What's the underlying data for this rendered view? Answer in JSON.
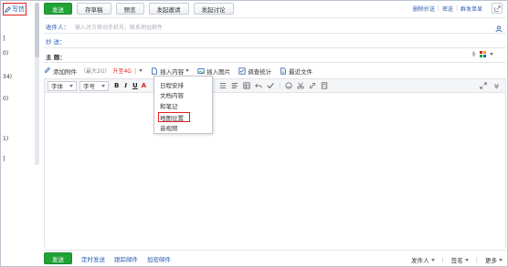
{
  "left": {
    "write_label": "写信",
    "fragments": [
      "]",
      "0)",
      "34)",
      "0)",
      "1)",
      "]"
    ]
  },
  "toolbar": {
    "send": "发送",
    "save_draft": "存草稿",
    "preview": "预览",
    "start_meeting": "发起邀请",
    "start_discussion": "发起讨论",
    "right_links": [
      "删除抄送",
      "密送",
      "群发单显"
    ]
  },
  "header": {
    "recipient_label": "收件人：",
    "recipient_placeholder": "输入对方移动手机号，联系地址邮件",
    "cc_label": "抄   送：",
    "subject_label": "主   题："
  },
  "attach": {
    "add_attachment": "添加附件",
    "size_note": "（最大2G）",
    "upgrade": "升至4G",
    "insert_content": "插入内容",
    "insert_image": "插入图片",
    "survey": "调查统计",
    "recent_files": "最近文件"
  },
  "format": {
    "font": "字体",
    "size": "字号",
    "bold": "B",
    "italic": "I",
    "underline": "U",
    "color": "A"
  },
  "dropdown": {
    "items": [
      "日程安排",
      "文档内容",
      "和笔记",
      "地图位置",
      "音视频"
    ]
  },
  "bottom": {
    "send": "发送",
    "scheduled_send": "定时发送",
    "track_mail": "跟踪邮件",
    "encrypted_mail": "加密邮件",
    "sender": "发件人",
    "signature": "签名",
    "more": "更多"
  },
  "colors": {
    "accent_green": "#21a336",
    "link_blue": "#2a5db0",
    "highlight_red": "#e02020"
  }
}
